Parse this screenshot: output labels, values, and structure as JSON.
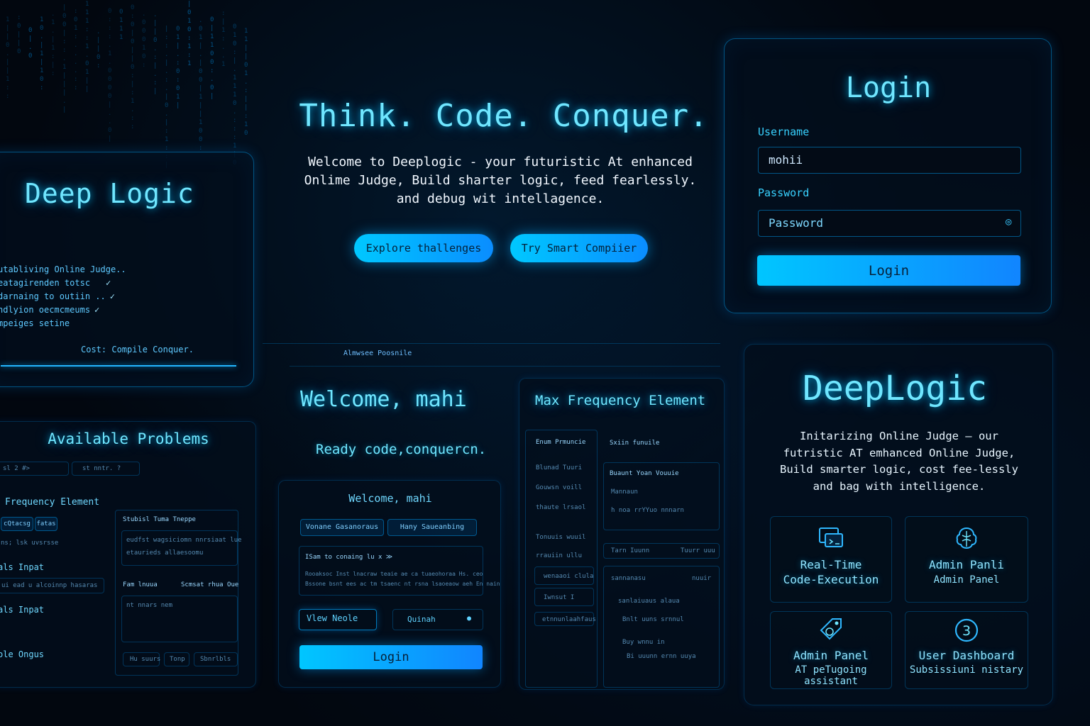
{
  "hero": {
    "title": "Think. Code. Conquer.",
    "description": "Welcome to Deeplogic - your futuristic At enhanced Onlime Judge, Build sharter logic, feed fearlessly. and debug wit intellagence.",
    "buttons": [
      "Explore thallenges",
      "Try Smart Compiier"
    ]
  },
  "login_card": {
    "title": "Login",
    "username_label": "Username",
    "username_value": "mohii",
    "password_label": "Password",
    "password_placeholder": "Password",
    "submit_label": "Login"
  },
  "deep_logic_card": {
    "title": "Deep Logic",
    "log_lines": [
      "utabliving Online Judge..",
      "eatagirenden totsc",
      "darnaing to outiin ..",
      "ndlyion oecmcmeums",
      "mpeiges setine"
    ],
    "footer": "Cost:  Compile  Conquer."
  },
  "problems_card": {
    "title": "Available Problems",
    "filters": [
      "sl 2 #>",
      "st nntr. ?"
    ],
    "items": [
      "Frequency Element",
      "als Inpat",
      "als Inpat",
      "ole Ongus"
    ],
    "tags": [
      "cQtacsg",
      "fatas"
    ],
    "meta": "ns;  lsk  uvsrsse",
    "sub_meta": "ui  ead  u alcoinnp hasaras",
    "side_title": "Stubisl  Tuma  Tneppe",
    "side_lines": [
      "eudfst  wagsiciomn  nnrsiaat lue",
      "etaurieds  allaesoomu"
    ],
    "side_row": [
      "Fam  lnuua",
      "Scmsat  rhua Oue"
    ],
    "side_body": "nt  nnars  nem",
    "side_buttons": [
      "Hu suurs",
      "Tonp",
      "Sbnrlbls"
    ]
  },
  "dashboard": {
    "top_label": "Almwsee  Poosnile",
    "welcome": "Welcome, mahi",
    "subtitle": "Ready code,conquercn.",
    "inner_welcome": "Welcome, mahi",
    "tabs": [
      "Vonane  Gasanoraus",
      "Hany  Saueanbing"
    ],
    "notice_title": "ISam  to  conaing lu x  ≫",
    "notice_lines": [
      "Rooaksoc  Inst lnacraw teaie  ae ca  tuaeohoraa Hs. ceo",
      "Bssone  bsnt ees ac  tm  tsaenc nt rsna  lsaoeaow aeh En   nain"
    ],
    "view_button": "Vlew  Neole",
    "outline_button": "Quinah",
    "login_button": "Login"
  },
  "problem_view": {
    "title": "Max Frequency Element",
    "col_left": "Enum  Prmuncie",
    "col_right": "Sxiin  funuile",
    "left_items": [
      "Blunad  Tuuri",
      "Gouwsn  voill",
      "thaute  lrsaol",
      "Tonuuis  wuuil",
      "rrauiin  ullu"
    ],
    "left_boxes": [
      "wenaaoi  clula",
      "Iwnsut  I",
      "etnnunlaahfaus"
    ],
    "right_header": "Buaunt  Yoan  Vouuie",
    "right_sub": "Mannaun",
    "right_line": "h  noa  rrYYuo  nnnarn",
    "right_bar": [
      "Tarn  Iuunn",
      "Tuurr  uuu"
    ],
    "right_box_head": [
      "sannanasu",
      "nuuir"
    ],
    "right_box_lines": [
      "sanlaiuaus  alaua",
      "Bnlt  uuns  srnnul",
      "Buy  wnnu  in",
      "Bi  uuunn  ernn  uuya"
    ]
  },
  "brand_card": {
    "title": "DeepLogic",
    "description": "Initarizing Online Judge – our futristic AT emhanced Online Judge, Build smarter logic, cost fee-lessly and bag with intelligence.",
    "features": [
      {
        "icon": "monitor-code-icon",
        "line1": "Real-Time",
        "line2": "Code-Execution"
      },
      {
        "icon": "brain-icon",
        "line1": "Admin Panli",
        "line2": "Admin Panel"
      },
      {
        "icon": "tag-icon",
        "line1": "Admin Panel",
        "line2": "AT peTugoing assistant"
      },
      {
        "icon": "number-three-icon",
        "line1": "User Dashboard",
        "line2": "Subsissiuni nistary"
      }
    ]
  },
  "theme": {
    "accent": "#00c8ff",
    "accent_deep": "#0a8dff",
    "background": "#02070f",
    "text_glow": "#6fe6ff"
  }
}
